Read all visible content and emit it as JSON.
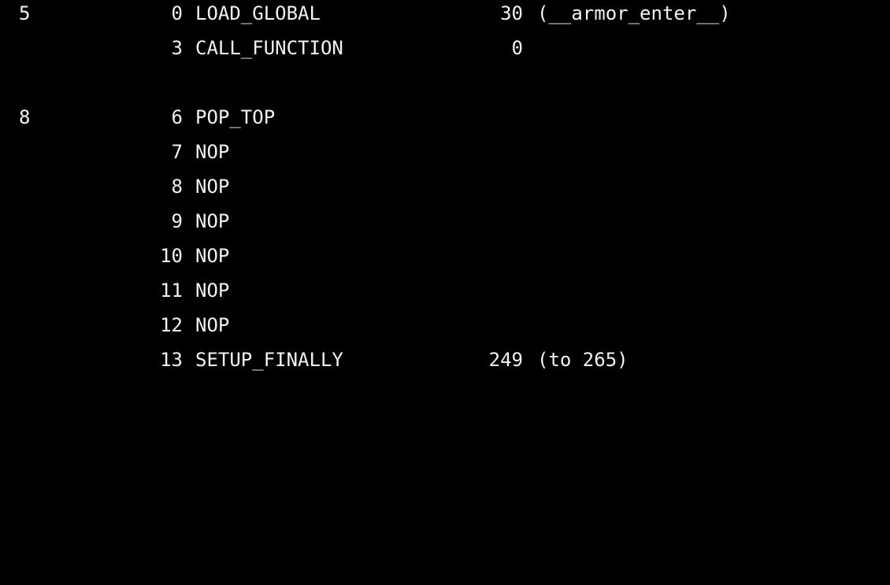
{
  "theme": {
    "background": "#000000",
    "foreground": "#f2f2f2"
  },
  "disassembly": [
    {
      "line_no": "5",
      "offset": "0",
      "opname": "LOAD_GLOBAL",
      "arg": "30",
      "argrepr": "(__armor_enter__)"
    },
    {
      "line_no": "",
      "offset": "3",
      "opname": "CALL_FUNCTION",
      "arg": "0",
      "argrepr": ""
    },
    {
      "line_no": "",
      "offset": "",
      "opname": "",
      "arg": "",
      "argrepr": ""
    },
    {
      "line_no": "8",
      "offset": "6",
      "opname": "POP_TOP",
      "arg": "",
      "argrepr": ""
    },
    {
      "line_no": "",
      "offset": "7",
      "opname": "NOP",
      "arg": "",
      "argrepr": ""
    },
    {
      "line_no": "",
      "offset": "8",
      "opname": "NOP",
      "arg": "",
      "argrepr": ""
    },
    {
      "line_no": "",
      "offset": "9",
      "opname": "NOP",
      "arg": "",
      "argrepr": ""
    },
    {
      "line_no": "",
      "offset": "10",
      "opname": "NOP",
      "arg": "",
      "argrepr": ""
    },
    {
      "line_no": "",
      "offset": "11",
      "opname": "NOP",
      "arg": "",
      "argrepr": ""
    },
    {
      "line_no": "",
      "offset": "12",
      "opname": "NOP",
      "arg": "",
      "argrepr": ""
    },
    {
      "line_no": "",
      "offset": "13",
      "opname": "SETUP_FINALLY",
      "arg": "249",
      "argrepr": "(to 265)"
    }
  ]
}
